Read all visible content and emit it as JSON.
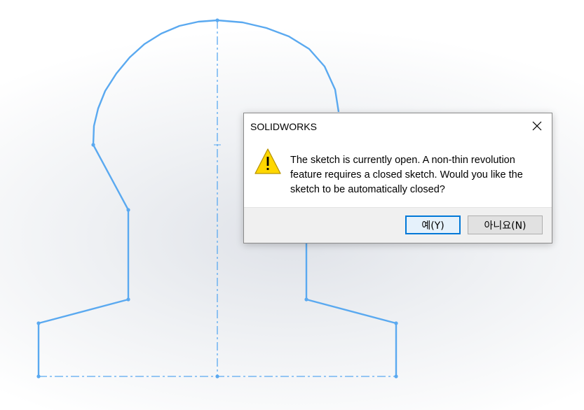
{
  "dialog": {
    "title": "SOLIDWORKS",
    "icon": "warning-icon",
    "message": "The sketch is currently open.  A non-thin revolution feature requires a closed sketch.  Would you like the sketch to be automatically closed?",
    "buttons": {
      "yes_label": "예(Y)",
      "no_label": "아니요(N)"
    },
    "close_icon": "close-icon"
  },
  "colors": {
    "sketch_line": "#5aa9f0",
    "dialog_accent": "#0078d7",
    "warning_fill": "#ffd700"
  }
}
